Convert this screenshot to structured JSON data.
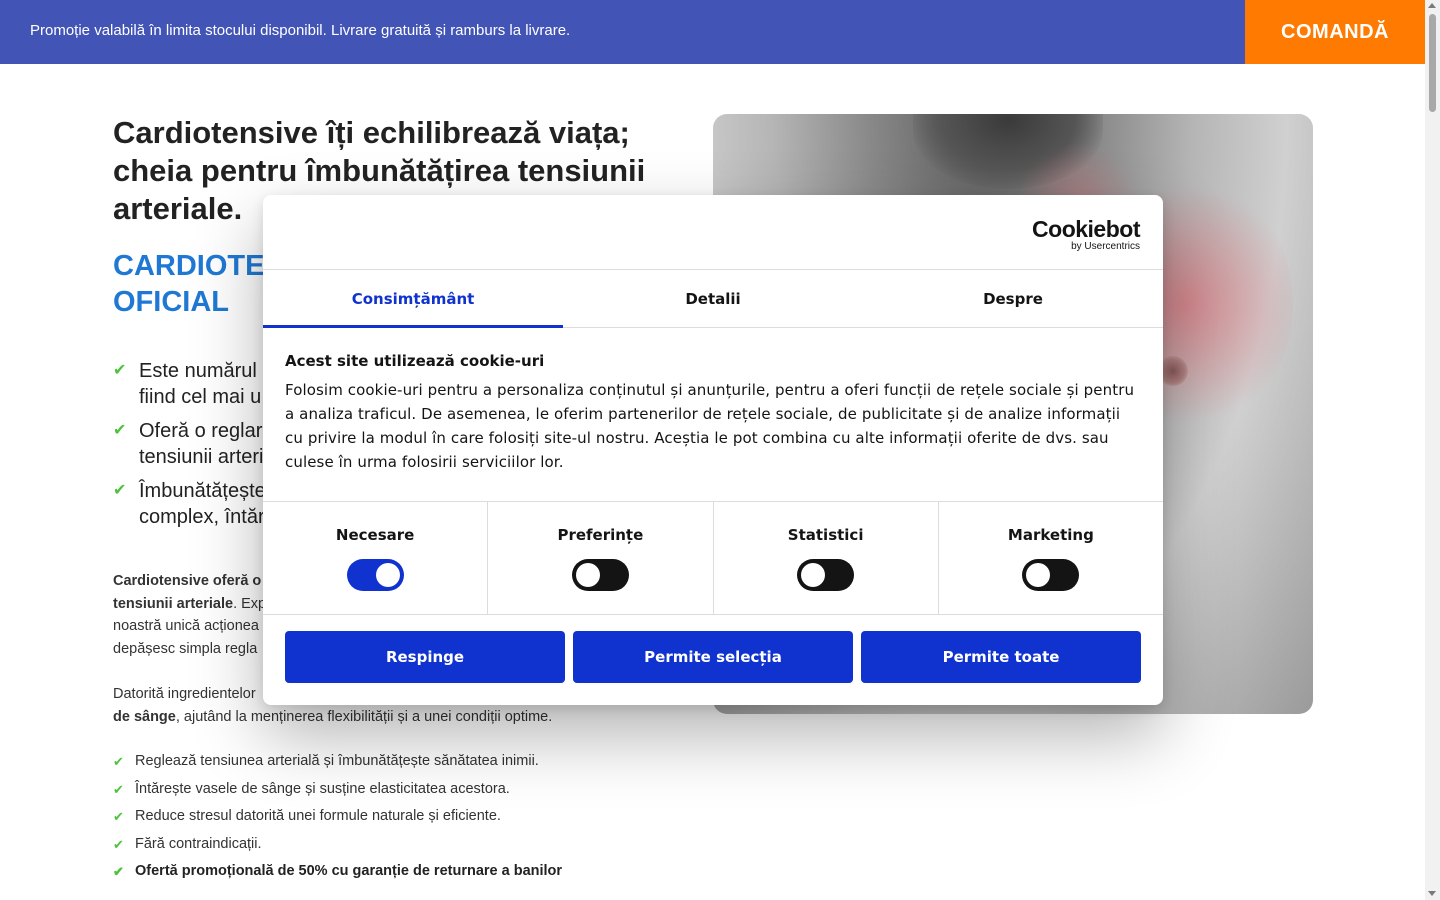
{
  "topbar": {
    "promo_text": "Promoție valabilă în limita stocului disponibil. Livrare gratuită și ramburs la livrare.",
    "order_label": "COMANDĂ",
    "bg_color": "#4254b5",
    "order_color": "#ff7a00"
  },
  "main": {
    "headline": "Cardiotensive îți echilibrează viața; cheia pentru îmbunătățirea tensiunii arteriale.",
    "subhead_line1": "CARDIOTEN",
    "subhead_line2": "OFICIAL",
    "features": [
      {
        "line1": "Este numărul u",
        "line2": "fiind cel mai u"
      },
      {
        "line1": "Oferă o reglare",
        "line2": "tensiunii arteri"
      },
      {
        "line1": "Îmbunătățește",
        "line2": "complex, întăr"
      }
    ],
    "para1": {
      "bold1": "Cardiotensive oferă o s",
      "bold2": "tensiunii arteriale",
      "text2": ". Exp",
      "line3": "noastră unică acționea",
      "line4": "depășesc simpla regla"
    },
    "para2": {
      "line1": "Datorită ingredientelor",
      "bold": "de sânge",
      "line2_rest": ", ajutând la menținerea flexibilității și a unei condiții optime."
    },
    "benefits": [
      "Reglează tensiunea arterială și îmbunătățește sănătatea inimii.",
      "Întărește vasele de sânge și susține elasticitatea acestora.",
      "Reduce stresul datorită unei formule naturale și eficiente.",
      "Fără contraindicații.",
      "Ofertă promoțională de 50% cu garanție de returnare a banilor"
    ],
    "check_icon": "✔"
  },
  "cookie": {
    "logo_main": "Cookiebot",
    "logo_sub": "by Usercentrics",
    "tabs": [
      "Consimțământ",
      "Detalii",
      "Despre"
    ],
    "title": "Acest site utilizează cookie-uri",
    "text": "Folosim cookie-uri pentru a personaliza conținutul și anunțurile, pentru a oferi funcții de rețele sociale și pentru a analiza traficul. De asemenea, le oferim partenerilor de rețele sociale, de publicitate și de analize informații cu privire la modul în care folosiți site-ul nostru. Aceștia le pot combina cu alte informații oferite de dvs. sau culese în urma folosirii serviciilor lor.",
    "toggles": [
      {
        "label": "Necesare",
        "on": true
      },
      {
        "label": "Preferințe",
        "on": false
      },
      {
        "label": "Statistici",
        "on": false
      },
      {
        "label": "Marketing",
        "on": false
      }
    ],
    "buttons": {
      "reject": "Respinge",
      "allow_selection": "Permite selecția",
      "allow_all": "Permite toate"
    },
    "accent_color": "#1032cf"
  }
}
